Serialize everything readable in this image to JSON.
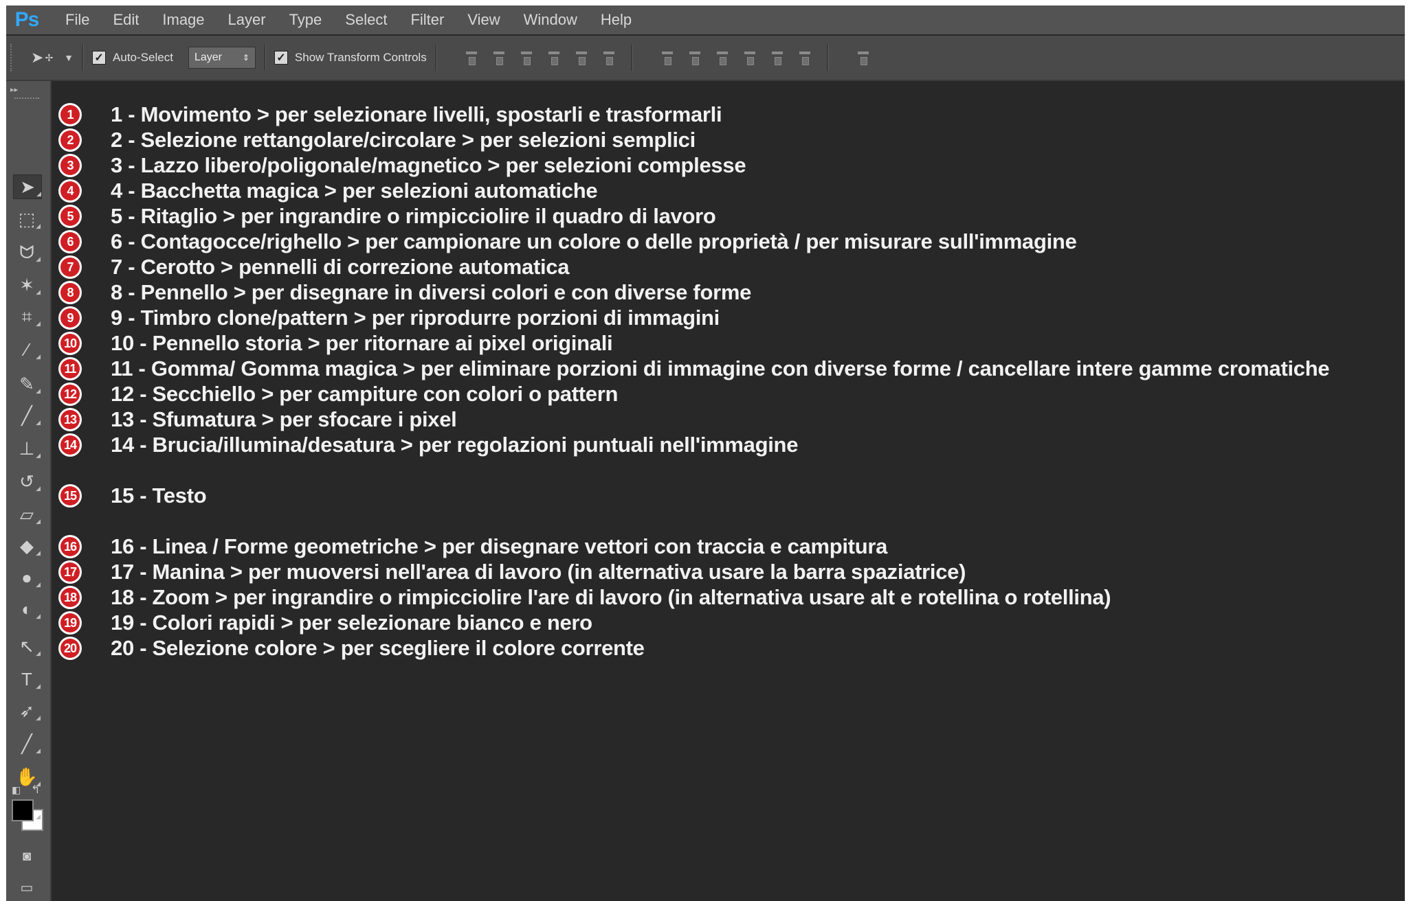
{
  "app": {
    "logo": "Ps"
  },
  "menu": [
    "File",
    "Edit",
    "Image",
    "Layer",
    "Type",
    "Select",
    "Filter",
    "View",
    "Window",
    "Help"
  ],
  "options_bar": {
    "auto_select_label": "Auto-Select",
    "auto_select_checked": true,
    "layer_select_value": "Layer",
    "show_transform_label": "Show Transform Controls",
    "show_transform_checked": true
  },
  "colors": {
    "badge": "#d01f24",
    "panel": "#282828",
    "chrome": "#535353"
  },
  "tools": [
    {
      "name": "move-tool-icon",
      "glyph": "➤"
    },
    {
      "name": "marquee-tool-icon",
      "glyph": "⬚"
    },
    {
      "name": "lasso-tool-icon",
      "glyph": "ᗢ"
    },
    {
      "name": "magic-wand-tool-icon",
      "glyph": "✶"
    },
    {
      "name": "crop-tool-icon",
      "glyph": "⌗"
    },
    {
      "name": "eyedropper-tool-icon",
      "glyph": "⁄"
    },
    {
      "name": "healing-brush-tool-icon",
      "glyph": "✎"
    },
    {
      "name": "brush-tool-icon",
      "glyph": "╱"
    },
    {
      "name": "clone-stamp-tool-icon",
      "glyph": "⊥"
    },
    {
      "name": "history-brush-tool-icon",
      "glyph": "↺"
    },
    {
      "name": "eraser-tool-icon",
      "glyph": "▱"
    },
    {
      "name": "paint-bucket-tool-icon",
      "glyph": "◆"
    },
    {
      "name": "blur-tool-icon",
      "glyph": "●"
    },
    {
      "name": "dodge-tool-icon",
      "glyph": "◐"
    },
    {
      "name": "pen-tool-icon",
      "glyph": "↖"
    },
    {
      "name": "type-tool-icon",
      "glyph": "T"
    },
    {
      "name": "path-selection-tool-icon",
      "glyph": "➶"
    },
    {
      "name": "line-tool-icon",
      "glyph": "╱"
    },
    {
      "name": "hand-tool-icon",
      "glyph": "✋"
    },
    {
      "name": "zoom-tool-icon",
      "glyph": "⚲"
    }
  ],
  "items": [
    {
      "n": "1",
      "text": "1 - Movimento > per selezionare livelli, spostarli e trasformarli"
    },
    {
      "n": "2",
      "text": "2 - Selezione rettangolare/circolare > per selezioni semplici"
    },
    {
      "n": "3",
      "text": "3 - Lazzo libero/poligonale/magnetico > per selezioni complesse"
    },
    {
      "n": "4",
      "text": "4 - Bacchetta magica > per selezioni automatiche"
    },
    {
      "n": "5",
      "text": "5 - Ritaglio > per ingrandire o rimpicciolire il quadro di lavoro"
    },
    {
      "n": "6",
      "text": "6 - Contagocce/righello > per campionare un colore o delle proprietà / per misurare sull'immagine"
    },
    {
      "n": "7",
      "text": "7 - Cerotto > pennelli di correzione automatica"
    },
    {
      "n": "8",
      "text": "8 -  Pennello > per disegnare in diversi colori e con diverse forme"
    },
    {
      "n": "9",
      "text": "9 - Timbro clone/pattern > per riprodurre porzioni di immagini"
    },
    {
      "n": "10",
      "text": "10 - Pennello storia > per ritornare ai pixel originali"
    },
    {
      "n": "11",
      "text": "11 - Gomma/ Gomma magica > per eliminare porzioni di immagine con diverse forme / cancellare intere gamme cromatiche"
    },
    {
      "n": "12",
      "text": "12 - Secchiello > per campiture con colori o pattern"
    },
    {
      "n": "13",
      "text": "13 - Sfumatura >  per sfocare i pixel"
    },
    {
      "n": "14",
      "text": "14 - Brucia/illumina/desatura > per regolazioni puntuali nell'immagine"
    },
    {
      "n": "15",
      "text": "15 - Testo"
    },
    {
      "n": "16",
      "text": "16 - Linea / Forme geometriche > per disegnare vettori con traccia e campitura"
    },
    {
      "n": "17",
      "text": "17 - Manina > per muoversi nell'area di lavoro (in alternativa usare la barra spaziatrice)"
    },
    {
      "n": "18",
      "text": "18 - Zoom > per ingrandire o rimpicciolire l'are di lavoro (in alternativa usare alt e rotellina o rotellina)"
    },
    {
      "n": "19",
      "text": "19 - Colori rapidi > per selezionare bianco e nero"
    },
    {
      "n": "20",
      "text": "20 - Selezione colore > per scegliere il colore corrente"
    }
  ]
}
